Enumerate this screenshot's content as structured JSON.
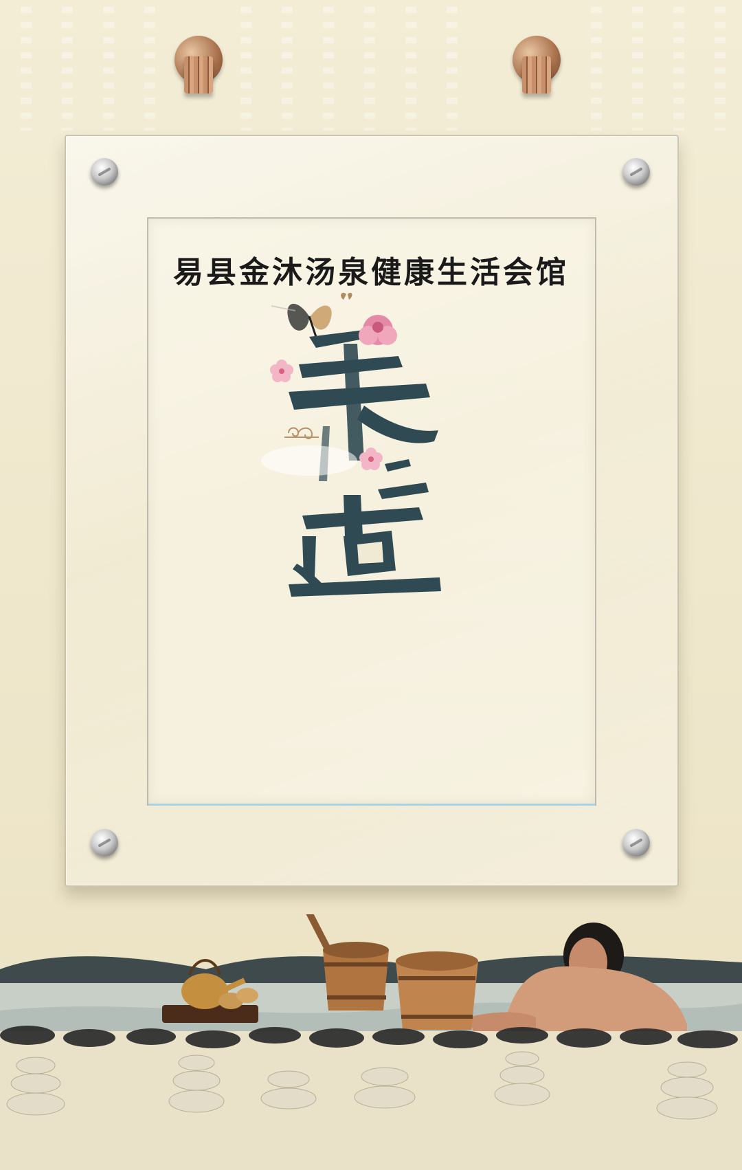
{
  "poster": {
    "title": "易县金沐汤泉健康生活会馆",
    "calligraphy_art": "养之道",
    "colors": {
      "background": "#efe7cb",
      "ink": "#2f4a52",
      "title": "#1a1a1a",
      "blossom": "#e48aa6"
    }
  }
}
